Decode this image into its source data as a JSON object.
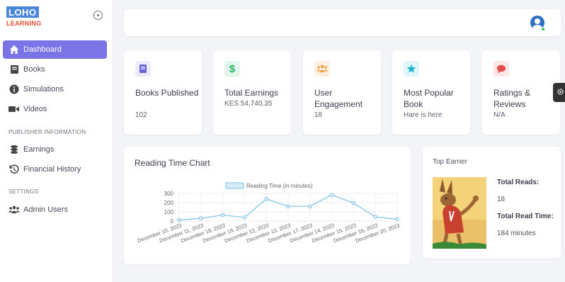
{
  "brand": {
    "logo_top": "LOHO",
    "logo_bottom": "LEARNING"
  },
  "sidebar": {
    "items": [
      {
        "label": "Dashboard",
        "icon": "home-icon"
      },
      {
        "label": "Books",
        "icon": "book-icon"
      },
      {
        "label": "Simulations",
        "icon": "info-icon"
      },
      {
        "label": "Videos",
        "icon": "video-icon"
      }
    ],
    "publisher_section": "PUBLISHER INFORMATION",
    "publisher_items": [
      {
        "label": "Earnings",
        "icon": "coins-icon"
      },
      {
        "label": "Financial History",
        "icon": "history-icon"
      }
    ],
    "settings_section": "SETTINGS",
    "settings_items": [
      {
        "label": "Admin Users",
        "icon": "users-icon"
      }
    ]
  },
  "cards": [
    {
      "title": "Books Published",
      "value": "102",
      "icon": "book-icon",
      "color": "#6a63d9",
      "bg": "#ecebfb"
    },
    {
      "title": "Total Earnings",
      "value": "KES 54,740.35",
      "icon": "dollar-icon",
      "color": "#28b463",
      "bg": "#e3f6ec"
    },
    {
      "title": "User Engagement",
      "value": "18",
      "icon": "users-icon",
      "color": "#f0a045",
      "bg": "#fdf0e1"
    },
    {
      "title": "Most Popular Book",
      "value": "Hare is here",
      "icon": "star-icon",
      "color": "#1fb6d1",
      "bg": "#e0f6fa"
    },
    {
      "title": "Ratings & Reviews",
      "value": "N/A",
      "icon": "chat-icon",
      "color": "#e74c4c",
      "bg": "#fde6e6"
    }
  ],
  "chart": {
    "title": "Reading Time Chart"
  },
  "chart_data": {
    "type": "line",
    "categories": [
      "December 10, 2023",
      "December 11, 2023",
      "December 18, 2023",
      "December 19, 2023",
      "December 12, 2023",
      "December 13, 2023",
      "December 17, 2023",
      "December 14, 2023",
      "December 15, 2023",
      "December 16, 2023",
      "December 20, 2023"
    ],
    "series": [
      {
        "name": "Reading Time (in minutes)",
        "values": [
          10,
          30,
          65,
          40,
          240,
          160,
          160,
          285,
          195,
          45,
          20
        ]
      }
    ],
    "ylim": [
      0,
      300
    ],
    "yticks": [
      0,
      100,
      200,
      300
    ],
    "color": "#7cc0e6"
  },
  "top_earner": {
    "title": "Top Earner",
    "reads_label": "Total Reads:",
    "reads_value": "18",
    "time_label": "Total Read Time:",
    "time_value": "184 minutes"
  }
}
